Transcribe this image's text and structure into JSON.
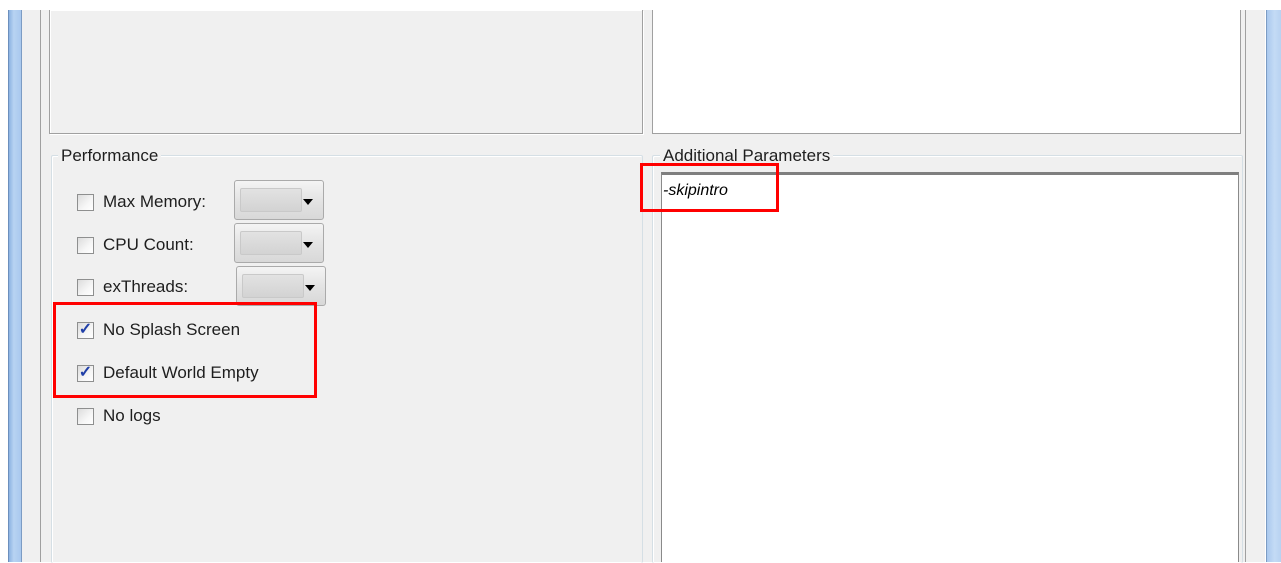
{
  "performance": {
    "title": "Performance",
    "options": [
      {
        "label": "Max Memory:",
        "checked": false,
        "has_dropdown": true
      },
      {
        "label": "CPU Count:",
        "checked": false,
        "has_dropdown": true
      },
      {
        "label": "exThreads:",
        "checked": false,
        "has_dropdown": true
      },
      {
        "label": "No Splash Screen",
        "checked": true
      },
      {
        "label": "Default World Empty",
        "checked": true
      },
      {
        "label": "No logs",
        "checked": false
      }
    ]
  },
  "additional_parameters": {
    "title": "Additional Parameters",
    "value": "-skipintro"
  },
  "colors": {
    "highlight": "#ff0000",
    "check_mark": "#2140a8",
    "window_frame": "#b8d3f2"
  }
}
